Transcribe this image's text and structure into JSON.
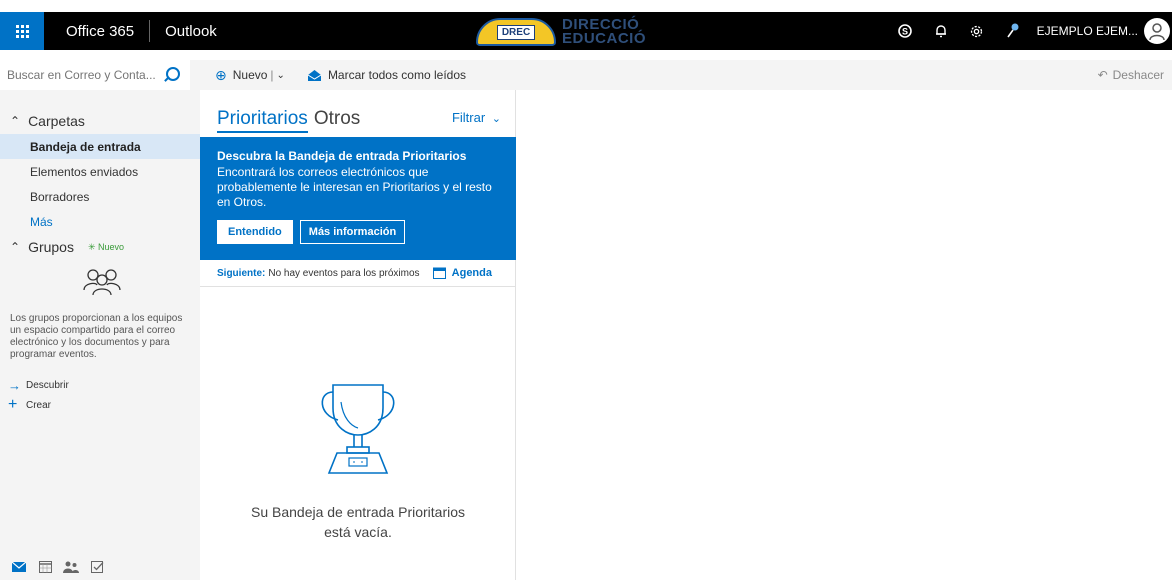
{
  "topbar": {
    "brand": "Office 365",
    "app": "Outlook",
    "logo_badge": "DREC",
    "logo_line1": "DIRECCIÓ",
    "logo_line2": "EDUCACIÓ",
    "user_name": "EJEMPLO EJEM...",
    "icons": [
      "app-launcher-icon",
      "skype-icon",
      "bell-icon",
      "gear-icon",
      "help-icon",
      "avatar-icon"
    ]
  },
  "search": {
    "placeholder": "Buscar en Correo y Conta..."
  },
  "command_bar": {
    "new_label": "Nuevo",
    "new_separator": "|",
    "mark_all_read": "Marcar todos como leídos",
    "undo": "Deshacer"
  },
  "leftnav": {
    "folders_heading": "Carpetas",
    "items": [
      {
        "label": "Bandeja de entrada",
        "selected": true
      },
      {
        "label": "Elementos enviados",
        "selected": false
      },
      {
        "label": "Borradores",
        "selected": false
      }
    ],
    "more": "Más",
    "groups_heading": "Grupos",
    "groups_new": "Nuevo",
    "groups_desc": "Los grupos proporcionan a los equipos un espacio compartido para el correo electrónico y los documentos y para programar eventos.",
    "discover": "Descubrir",
    "create": "Crear"
  },
  "listpane": {
    "pivot_focused": "Prioritarios",
    "pivot_other": "Otros",
    "filter": "Filtrar",
    "promo": {
      "title": "Descubra la Bandeja de entrada Prioritarios",
      "body": "Encontrará los correos electrónicos que probablemente le interesan en Prioritarios y el resto en Otros.",
      "ok_button": "Entendido",
      "more_button": "Más información"
    },
    "agenda": {
      "label": "Siguiente:",
      "text": "No hay eventos para los próximos",
      "link": "Agenda"
    },
    "empty_line1": "Su Bandeja de entrada Prioritarios",
    "empty_line2": "está vacía."
  },
  "colors": {
    "accent": "#0072c6",
    "topbar": "#000000",
    "selected_nav": "#d8e7f6"
  }
}
